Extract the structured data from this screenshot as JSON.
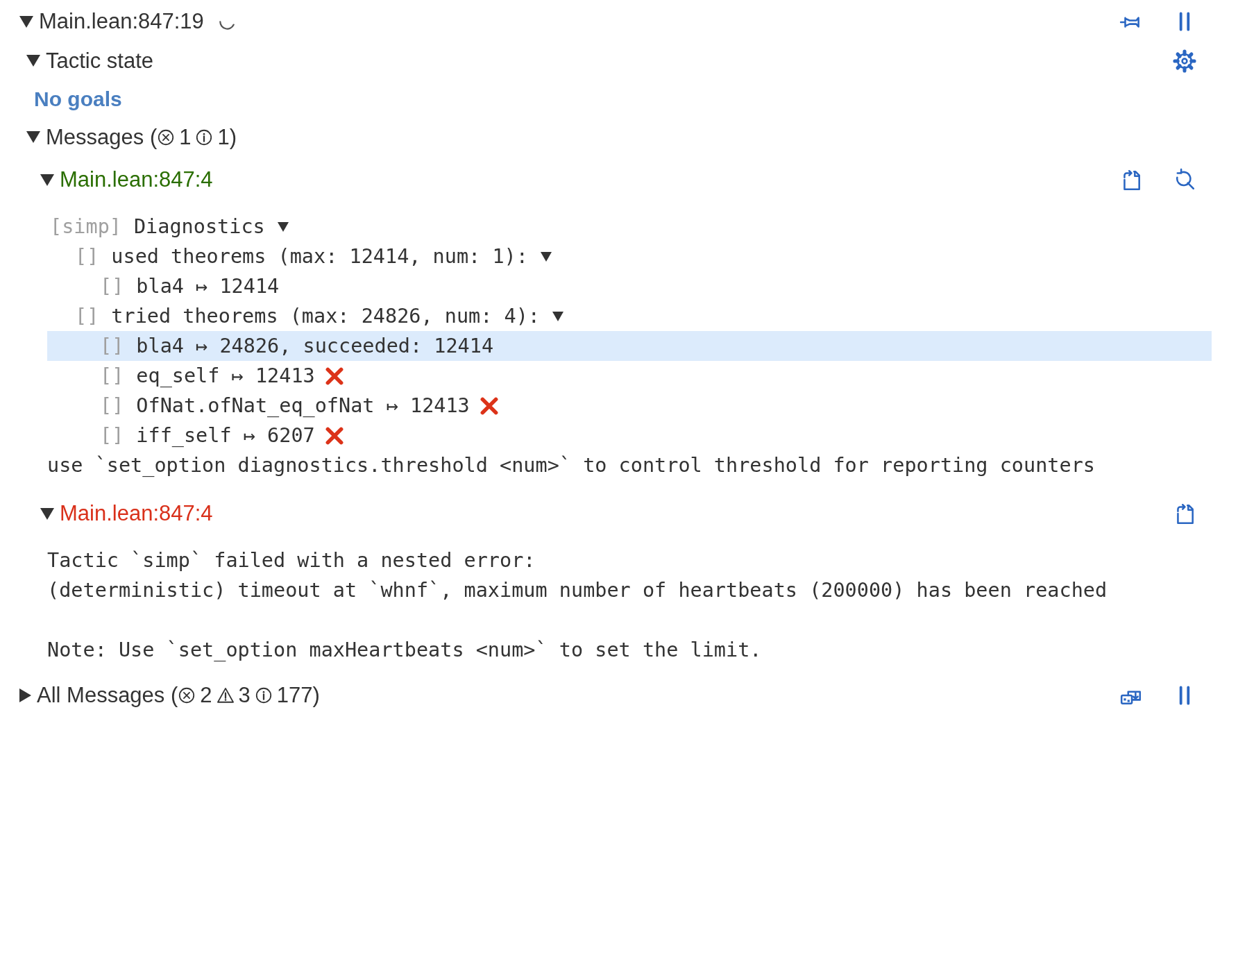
{
  "goal": {
    "location": "Main.lean:847:19",
    "expanded": true,
    "loading": true,
    "actions": [
      {
        "kind": "pin"
      },
      {
        "kind": "pause"
      }
    ]
  },
  "tactic_state": {
    "label": "Tactic state",
    "expanded": true,
    "text": "No goals",
    "actions": [
      {
        "kind": "settings"
      }
    ]
  },
  "messages": {
    "label": "Messages (",
    "expanded": true,
    "counts": [
      {
        "kind": "error",
        "count": "1"
      },
      {
        "kind": "info",
        "count": "1)"
      }
    ],
    "items": [
      {
        "kind": "info",
        "location": "Main.lean:847:4",
        "expanded": true,
        "actions": [
          {
            "kind": "copy"
          },
          {
            "kind": "goto"
          }
        ],
        "tree": {
          "tag": "[simp]",
          "text": "Diagnostics",
          "expanded": true,
          "selected": false,
          "children": [
            {
              "tag": "[]",
              "text": "used theorems (max: 12414, num: 1):",
              "expanded": true,
              "selected": false,
              "children": [
                {
                  "tag": "[]",
                  "text": "bla4 ↦ 12414",
                  "selected": false,
                  "failed": false
                }
              ]
            },
            {
              "tag": "[]",
              "text": "tried theorems (max: 24826, num: 4):",
              "expanded": true,
              "selected": false,
              "children": [
                {
                  "tag": "[]",
                  "text": "bla4 ↦ 24826, succeeded: 12414",
                  "selected": true,
                  "failed": false
                },
                {
                  "tag": "[]",
                  "text": "eq_self ↦ 12413",
                  "selected": false,
                  "failed": true
                },
                {
                  "tag": "[]",
                  "text": "OfNat.ofNat_eq_ofNat ↦ 12413",
                  "selected": false,
                  "failed": true
                },
                {
                  "tag": "[]",
                  "text": "iff_self ↦ 6207",
                  "selected": false,
                  "failed": true
                }
              ]
            }
          ]
        },
        "footer": "use `set_option diagnostics.threshold <num>` to control threshold for reporting counters"
      },
      {
        "kind": "error",
        "location": "Main.lean:847:4",
        "expanded": true,
        "actions": [
          {
            "kind": "copy"
          }
        ],
        "paragraphs": [
          "Tactic `simp` failed with a nested error:\n(deterministic) timeout at `whnf`, maximum number of heartbeats (200000) has been reached",
          "Note: Use `set_option maxHeartbeats <num>` to set the limit."
        ]
      }
    ]
  },
  "all_messages": {
    "label": "All Messages (",
    "expanded": false,
    "counts": [
      {
        "kind": "error",
        "count": "2"
      },
      {
        "kind": "warning",
        "count": "3"
      },
      {
        "kind": "info",
        "count": "177)"
      }
    ],
    "actions": [
      {
        "kind": "follow"
      },
      {
        "kind": "pause"
      }
    ]
  }
}
